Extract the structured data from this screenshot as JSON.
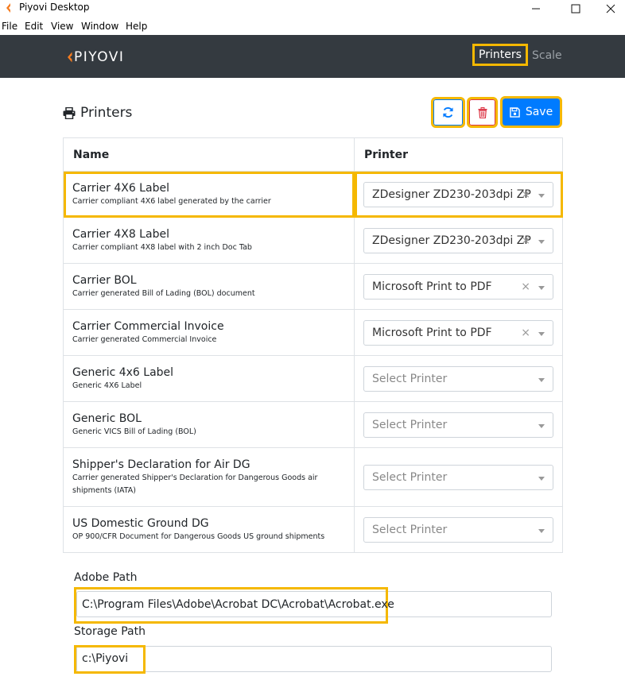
{
  "window": {
    "title": "Piyovi Desktop"
  },
  "menu": [
    "File",
    "Edit",
    "View",
    "Window",
    "Help"
  ],
  "navbar": {
    "logo": "PIYOVI",
    "links": [
      {
        "label": "Printers",
        "active": true
      },
      {
        "label": "Scale",
        "active": false
      }
    ]
  },
  "page": {
    "title": "Printers",
    "toolbar": {
      "refresh_icon": "refresh-icon",
      "delete_icon": "trash-icon",
      "save_label": "Save"
    }
  },
  "table": {
    "headers": [
      "Name",
      "Printer"
    ],
    "rows": [
      {
        "name": "Carrier 4X6 Label",
        "description": "Carrier compliant 4X6 label generated by the carrier",
        "printer": "ZDesigner ZD230-203dpi ZPL",
        "placeholder": false
      },
      {
        "name": "Carrier 4X8 Label",
        "description": "Carrier compliant 4X8 label with 2 inch Doc Tab",
        "printer": "ZDesigner ZD230-203dpi ZPL",
        "placeholder": false
      },
      {
        "name": "Carrier BOL",
        "description": "Carrier generated Bill of Lading (BOL) document",
        "printer": "Microsoft Print to PDF",
        "placeholder": false
      },
      {
        "name": "Carrier Commercial Invoice",
        "description": "Carrier generated Commercial Invoice",
        "printer": "Microsoft Print to PDF",
        "placeholder": false
      },
      {
        "name": "Generic 4x6 Label",
        "description": "Generic 4X6 Label",
        "printer": "Select Printer",
        "placeholder": true
      },
      {
        "name": "Generic BOL",
        "description": "Generic VICS Bill of Lading (BOL)",
        "printer": "Select Printer",
        "placeholder": true
      },
      {
        "name": "Shipper's Declaration for Air DG",
        "description": "Carrier generated Shipper's Declaration for Dangerous Goods air shipments (IATA)",
        "printer": "Select Printer",
        "placeholder": true
      },
      {
        "name": "US Domestic Ground DG",
        "description": "OP 900/CFR Document for Dangerous Goods US ground shipments",
        "printer": "Select Printer",
        "placeholder": true
      }
    ]
  },
  "paths": {
    "adobe_label": "Adobe Path",
    "adobe_value": "C:\\Program Files\\Adobe\\Acrobat DC\\Acrobat\\Acrobat.exe",
    "storage_label": "Storage Path",
    "storage_value": "c:\\Piyovi"
  },
  "colors": {
    "navbar": "#343a40",
    "primary": "#007bff",
    "highlight": "#f5b800",
    "danger": "#dc3545",
    "logo_accent": "#f57c20"
  }
}
